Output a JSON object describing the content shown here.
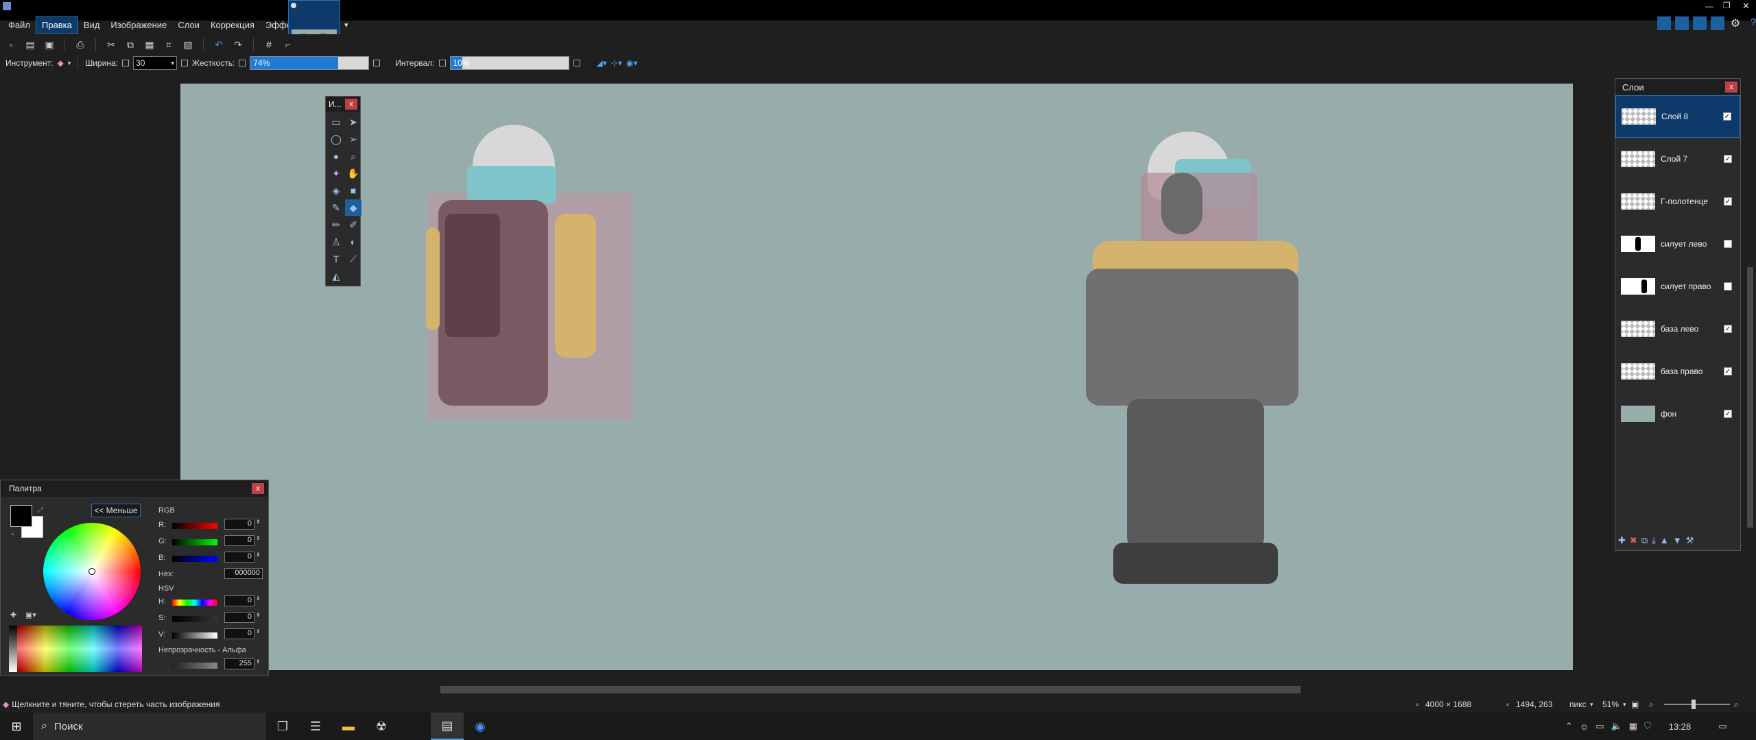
{
  "menubar": {
    "items": [
      "Файл",
      "Правка",
      "Вид",
      "Изображение",
      "Слои",
      "Коррекция",
      "Эффекты"
    ],
    "active_index": 1
  },
  "toolbar2": {
    "tool_label": "Инструмент:",
    "width_label": "Ширина:",
    "width_value": "30",
    "hardness_label": "Жесткость:",
    "hardness_value": "74%",
    "hardness_fraction": 0.74,
    "interval_label": "Интервал:",
    "interval_value": "10%",
    "interval_fraction": 0.1
  },
  "tools_window": {
    "title": "И...",
    "close": "x"
  },
  "palette": {
    "title": "Палитра",
    "close": "x",
    "less_button": "<< Меньше",
    "rgb_label": "RGB",
    "r_label": "R:",
    "g_label": "G:",
    "b_label": "B:",
    "r_value": "0",
    "g_value": "0",
    "b_value": "0",
    "hex_label": "Hex:",
    "hex_value": "000000",
    "hsv_label": "HSV",
    "h_label": "H:",
    "s_label": "S:",
    "v_label": "V:",
    "h_value": "0",
    "s_value": "0",
    "v_value": "0",
    "opacity_label": "Непрозрачность - Альфа",
    "alpha_value": "255"
  },
  "layers": {
    "title": "Слои",
    "close": "x",
    "items": [
      {
        "name": "Слой 8",
        "visible": true,
        "selected": true
      },
      {
        "name": "Слой 7",
        "visible": true,
        "selected": false
      },
      {
        "name": "Г-полотенце",
        "visible": true,
        "selected": false
      },
      {
        "name": "силует лево",
        "visible": false,
        "selected": false
      },
      {
        "name": "силует право",
        "visible": false,
        "selected": false
      },
      {
        "name": "база лево",
        "visible": true,
        "selected": false
      },
      {
        "name": "база право",
        "visible": true,
        "selected": false
      },
      {
        "name": "фон",
        "visible": true,
        "selected": false
      }
    ],
    "check_mark": "✓"
  },
  "statusbar": {
    "hint": "Щелкните и тяните, чтобы стереть часть изображения",
    "image_size": "4000 × 1688",
    "cursor_pos": "1494, 263",
    "units": "пикс",
    "zoom": "51%"
  },
  "taskbar": {
    "search_placeholder": "Поиск",
    "time": "13:28"
  },
  "colors": {
    "canvas_bg": "#98acab",
    "accent": "#1e7bd8",
    "selection": "#0d3a6b"
  }
}
